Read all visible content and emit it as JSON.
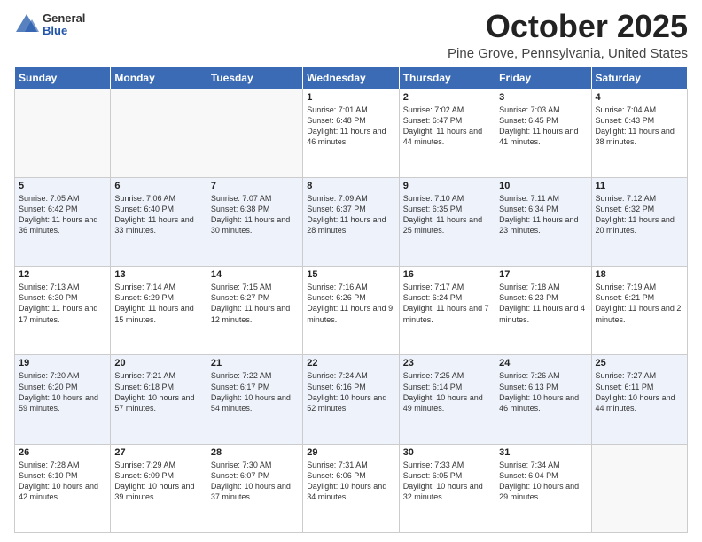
{
  "header": {
    "logo_general": "General",
    "logo_blue": "Blue",
    "month_title": "October 2025",
    "location": "Pine Grove, Pennsylvania, United States"
  },
  "days_of_week": [
    "Sunday",
    "Monday",
    "Tuesday",
    "Wednesday",
    "Thursday",
    "Friday",
    "Saturday"
  ],
  "weeks": [
    [
      {
        "day": "",
        "content": ""
      },
      {
        "day": "",
        "content": ""
      },
      {
        "day": "",
        "content": ""
      },
      {
        "day": "1",
        "content": "Sunrise: 7:01 AM\nSunset: 6:48 PM\nDaylight: 11 hours and 46 minutes."
      },
      {
        "day": "2",
        "content": "Sunrise: 7:02 AM\nSunset: 6:47 PM\nDaylight: 11 hours and 44 minutes."
      },
      {
        "day": "3",
        "content": "Sunrise: 7:03 AM\nSunset: 6:45 PM\nDaylight: 11 hours and 41 minutes."
      },
      {
        "day": "4",
        "content": "Sunrise: 7:04 AM\nSunset: 6:43 PM\nDaylight: 11 hours and 38 minutes."
      }
    ],
    [
      {
        "day": "5",
        "content": "Sunrise: 7:05 AM\nSunset: 6:42 PM\nDaylight: 11 hours and 36 minutes."
      },
      {
        "day": "6",
        "content": "Sunrise: 7:06 AM\nSunset: 6:40 PM\nDaylight: 11 hours and 33 minutes."
      },
      {
        "day": "7",
        "content": "Sunrise: 7:07 AM\nSunset: 6:38 PM\nDaylight: 11 hours and 30 minutes."
      },
      {
        "day": "8",
        "content": "Sunrise: 7:09 AM\nSunset: 6:37 PM\nDaylight: 11 hours and 28 minutes."
      },
      {
        "day": "9",
        "content": "Sunrise: 7:10 AM\nSunset: 6:35 PM\nDaylight: 11 hours and 25 minutes."
      },
      {
        "day": "10",
        "content": "Sunrise: 7:11 AM\nSunset: 6:34 PM\nDaylight: 11 hours and 23 minutes."
      },
      {
        "day": "11",
        "content": "Sunrise: 7:12 AM\nSunset: 6:32 PM\nDaylight: 11 hours and 20 minutes."
      }
    ],
    [
      {
        "day": "12",
        "content": "Sunrise: 7:13 AM\nSunset: 6:30 PM\nDaylight: 11 hours and 17 minutes."
      },
      {
        "day": "13",
        "content": "Sunrise: 7:14 AM\nSunset: 6:29 PM\nDaylight: 11 hours and 15 minutes."
      },
      {
        "day": "14",
        "content": "Sunrise: 7:15 AM\nSunset: 6:27 PM\nDaylight: 11 hours and 12 minutes."
      },
      {
        "day": "15",
        "content": "Sunrise: 7:16 AM\nSunset: 6:26 PM\nDaylight: 11 hours and 9 minutes."
      },
      {
        "day": "16",
        "content": "Sunrise: 7:17 AM\nSunset: 6:24 PM\nDaylight: 11 hours and 7 minutes."
      },
      {
        "day": "17",
        "content": "Sunrise: 7:18 AM\nSunset: 6:23 PM\nDaylight: 11 hours and 4 minutes."
      },
      {
        "day": "18",
        "content": "Sunrise: 7:19 AM\nSunset: 6:21 PM\nDaylight: 11 hours and 2 minutes."
      }
    ],
    [
      {
        "day": "19",
        "content": "Sunrise: 7:20 AM\nSunset: 6:20 PM\nDaylight: 10 hours and 59 minutes."
      },
      {
        "day": "20",
        "content": "Sunrise: 7:21 AM\nSunset: 6:18 PM\nDaylight: 10 hours and 57 minutes."
      },
      {
        "day": "21",
        "content": "Sunrise: 7:22 AM\nSunset: 6:17 PM\nDaylight: 10 hours and 54 minutes."
      },
      {
        "day": "22",
        "content": "Sunrise: 7:24 AM\nSunset: 6:16 PM\nDaylight: 10 hours and 52 minutes."
      },
      {
        "day": "23",
        "content": "Sunrise: 7:25 AM\nSunset: 6:14 PM\nDaylight: 10 hours and 49 minutes."
      },
      {
        "day": "24",
        "content": "Sunrise: 7:26 AM\nSunset: 6:13 PM\nDaylight: 10 hours and 46 minutes."
      },
      {
        "day": "25",
        "content": "Sunrise: 7:27 AM\nSunset: 6:11 PM\nDaylight: 10 hours and 44 minutes."
      }
    ],
    [
      {
        "day": "26",
        "content": "Sunrise: 7:28 AM\nSunset: 6:10 PM\nDaylight: 10 hours and 42 minutes."
      },
      {
        "day": "27",
        "content": "Sunrise: 7:29 AM\nSunset: 6:09 PM\nDaylight: 10 hours and 39 minutes."
      },
      {
        "day": "28",
        "content": "Sunrise: 7:30 AM\nSunset: 6:07 PM\nDaylight: 10 hours and 37 minutes."
      },
      {
        "day": "29",
        "content": "Sunrise: 7:31 AM\nSunset: 6:06 PM\nDaylight: 10 hours and 34 minutes."
      },
      {
        "day": "30",
        "content": "Sunrise: 7:33 AM\nSunset: 6:05 PM\nDaylight: 10 hours and 32 minutes."
      },
      {
        "day": "31",
        "content": "Sunrise: 7:34 AM\nSunset: 6:04 PM\nDaylight: 10 hours and 29 minutes."
      },
      {
        "day": "",
        "content": ""
      }
    ]
  ]
}
